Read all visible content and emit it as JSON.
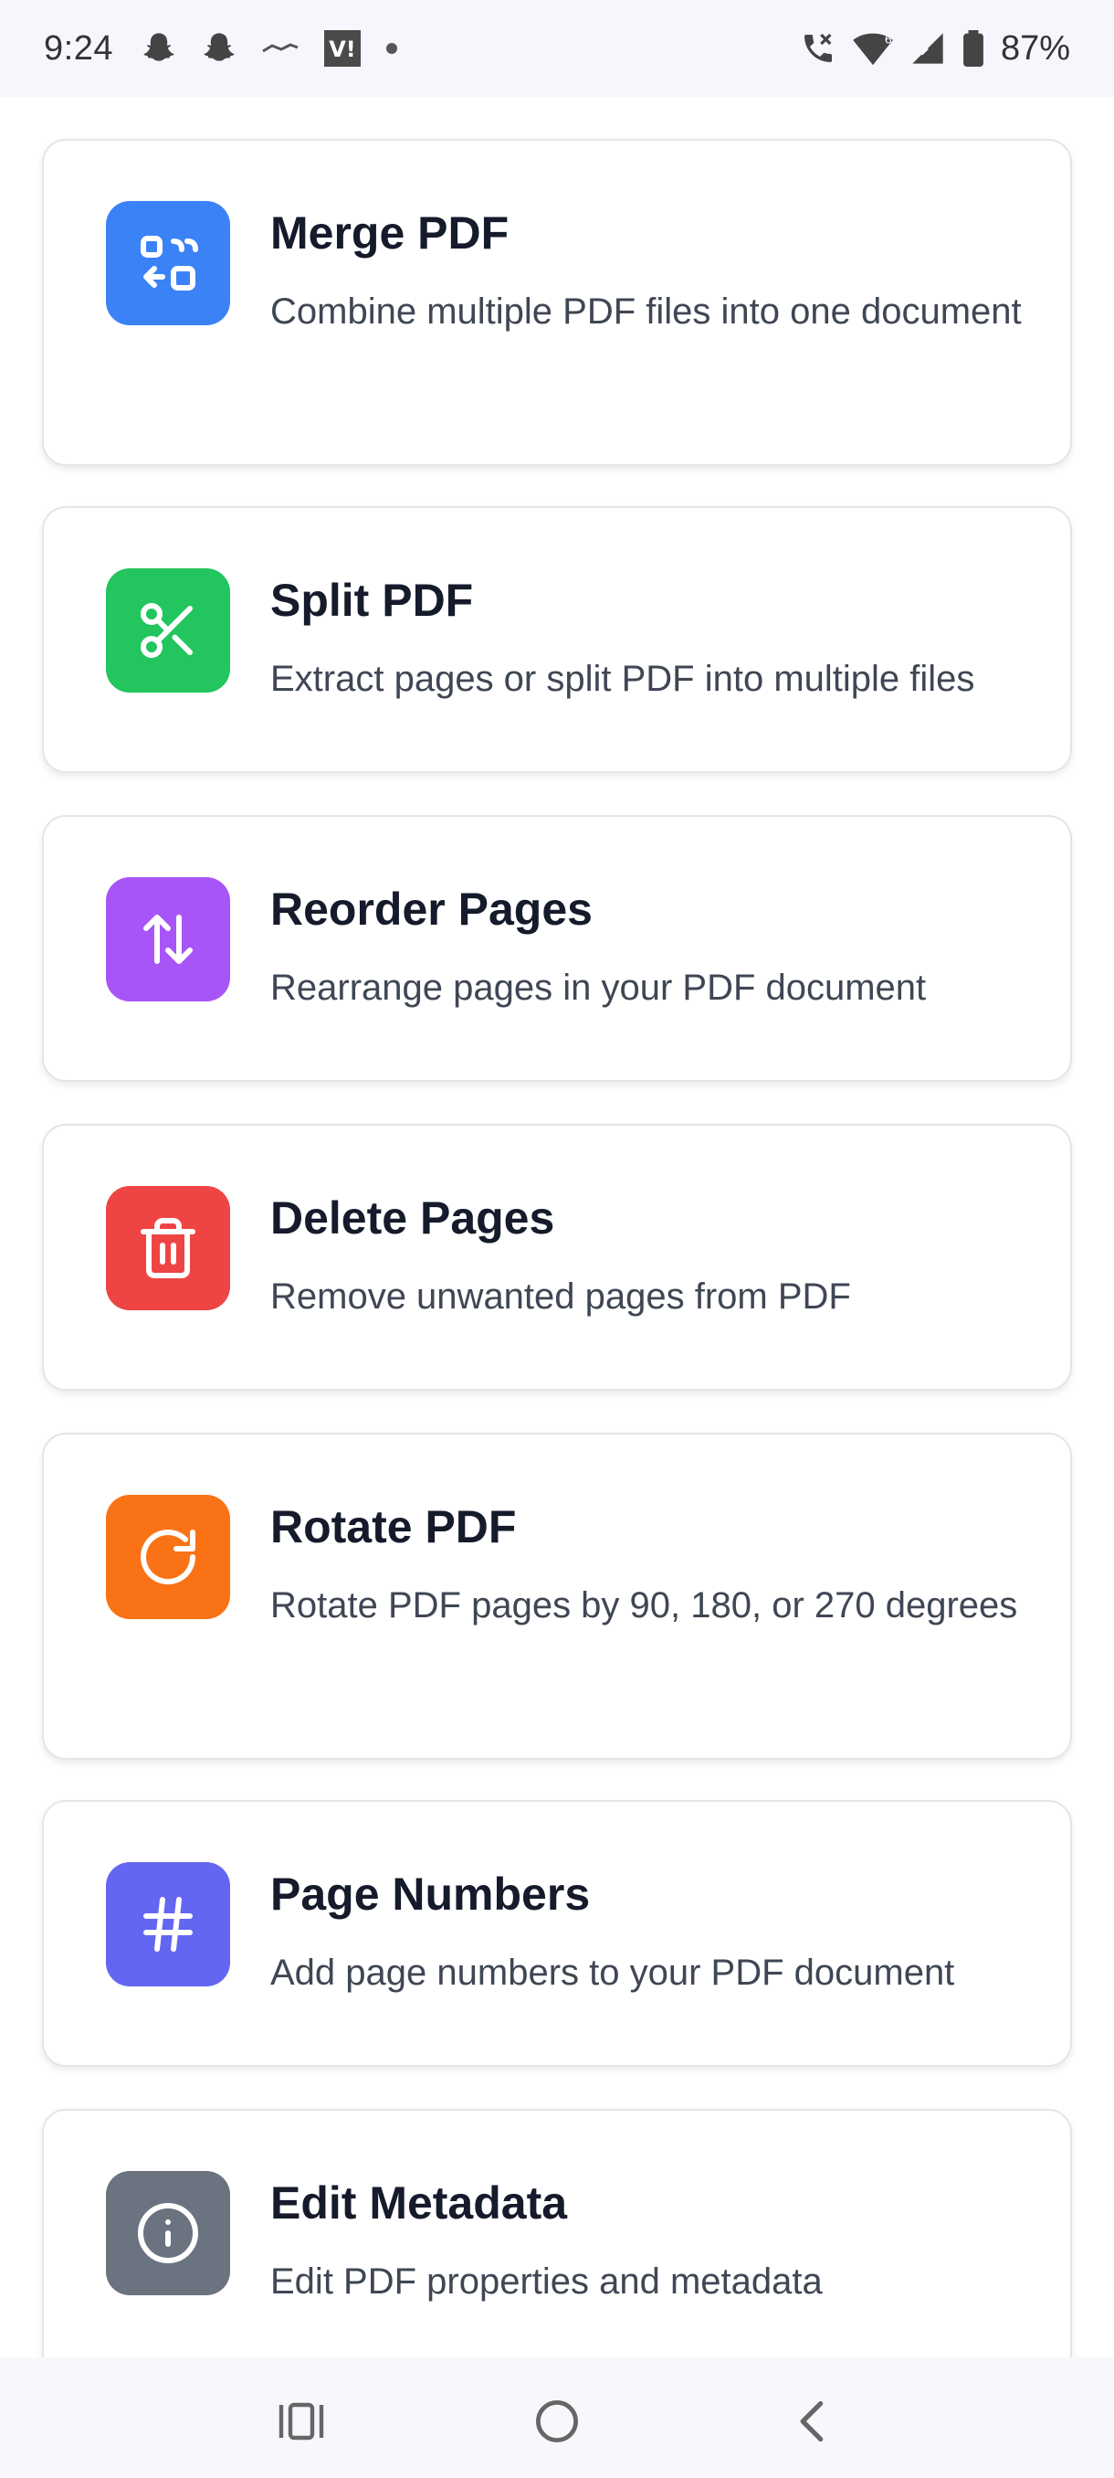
{
  "status_bar": {
    "time": "9:24",
    "battery": "87%",
    "icons": [
      "snapchat-ghost-icon",
      "snapchat-ghost-icon",
      "app-logo-icon",
      "vi-app-icon",
      "dot-icon",
      "wifi-calling-icon",
      "wifi-icon",
      "signal-icon",
      "battery-icon"
    ]
  },
  "tools": [
    {
      "title": "Merge PDF",
      "description": "Combine multiple PDF files into one document",
      "icon": "merge-icon",
      "color": "#3b82f6"
    },
    {
      "title": "Split PDF",
      "description": "Extract pages or split PDF into multiple files",
      "icon": "scissors-icon",
      "color": "#22c55e"
    },
    {
      "title": "Reorder Pages",
      "description": "Rearrange pages in your PDF document",
      "icon": "arrows-up-down-icon",
      "color": "#a855f7"
    },
    {
      "title": "Delete Pages",
      "description": "Remove unwanted pages from PDF",
      "icon": "trash-icon",
      "color": "#ef4444"
    },
    {
      "title": "Rotate PDF",
      "description": "Rotate PDF pages by 90, 180, or 270 degrees",
      "icon": "rotate-icon",
      "color": "#f97316"
    },
    {
      "title": "Page Numbers",
      "description": "Add page numbers to your PDF document",
      "icon": "hash-icon",
      "color": "#6366f1"
    },
    {
      "title": "Edit Metadata",
      "description": "Edit PDF properties and metadata",
      "icon": "info-icon",
      "color": "#6b7280"
    }
  ],
  "nav_bar": {
    "buttons": [
      "recent-apps-icon",
      "home-icon",
      "back-icon"
    ]
  }
}
